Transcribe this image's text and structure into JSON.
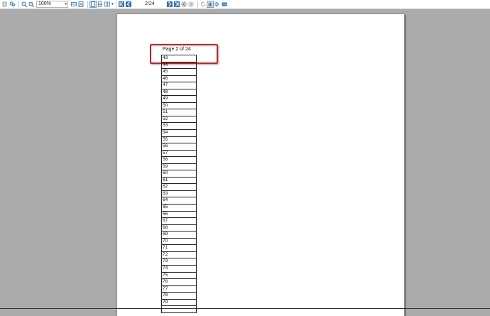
{
  "toolbar": {
    "zoom_value": "100%",
    "page_counter": "2/24",
    "icons": [
      "thumbnails-icon",
      "find-icon",
      "zoom-in-icon",
      "zoom-out-icon",
      "fit-width-icon",
      "fit-page-icon",
      "single-page-icon",
      "continuous-icon",
      "facing-icon",
      "first-page-icon",
      "previous-page-icon",
      "next-page-icon",
      "last-page-icon",
      "back-icon",
      "forward-icon",
      "refresh-icon",
      "hand-tool-icon",
      "select-tool-icon",
      "export-icon"
    ]
  },
  "document": {
    "page_label": "Page 2 of 24",
    "numbers": [
      "43",
      "44",
      "45",
      "46",
      "47",
      "48",
      "49",
      "50",
      "51",
      "52",
      "53",
      "54",
      "55",
      "56",
      "57",
      "58",
      "59",
      "60",
      "61",
      "62",
      "63",
      "64",
      "65",
      "66",
      "67",
      "68",
      "69",
      "70",
      "71",
      "72",
      "73",
      "74",
      "75",
      "76",
      "77",
      "78",
      "79",
      ""
    ]
  },
  "colors": {
    "highlight": "#d01c24",
    "viewer_background": "#ababab",
    "accent": "#2f6fbf"
  }
}
